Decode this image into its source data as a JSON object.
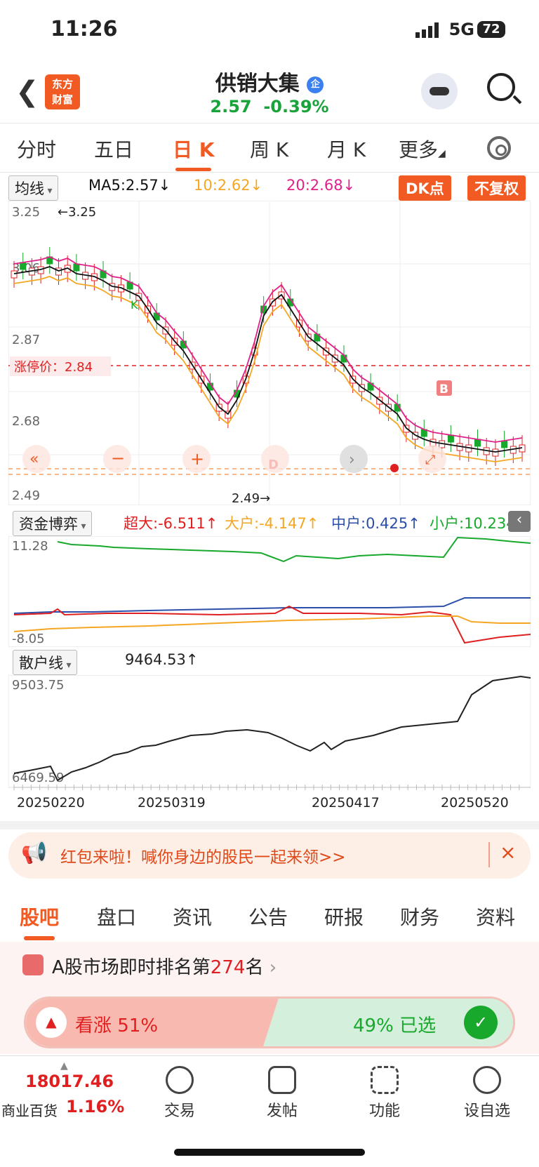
{
  "status": {
    "time": "11:26",
    "network": "5G",
    "battery": "72"
  },
  "header": {
    "logo_line1": "东方",
    "logo_line2": "财富",
    "stock_name": "供销大集",
    "badge": "企",
    "price": "2.57",
    "change": "-0.39%"
  },
  "period_tabs": [
    {
      "label": "分时"
    },
    {
      "label": "五日"
    },
    {
      "label": "日 K"
    },
    {
      "label": "周 K"
    },
    {
      "label": "月 K"
    },
    {
      "label": "更多"
    }
  ],
  "ma_row": {
    "select": "均线",
    "ma5": "MA5:2.57↓",
    "ma10": "10:2.62↓",
    "ma20": "20:2.68↓",
    "dk_button": "DK点",
    "fq_button": "不复权"
  },
  "kline": {
    "y_labels": [
      "3.25",
      "3.06",
      "2.87",
      "2.68",
      "2.49"
    ],
    "high_mark": "←3.25",
    "low_mark": "2.49→",
    "limit_label": "涨停价：2.84",
    "marker_b": "B",
    "marker_d": "D",
    "marker_k": "K"
  },
  "fund_row": {
    "select": "资金博弈",
    "super": "超大:-6.511↑",
    "large": "大户:-4.147↑",
    "mid": "中户:0.425↑",
    "small": "小户:10.234↑",
    "top": "11.28",
    "bottom": "-8.05"
  },
  "retail_row": {
    "select": "散户线",
    "value": "9464.53↑",
    "top": "9503.75",
    "bottom": "6469.59"
  },
  "dates": [
    "20250220",
    "20250319",
    "20250417",
    "20250520"
  ],
  "banner": {
    "text": "红包来啦！喊你身边的股民一起来领>>"
  },
  "section_tabs": [
    {
      "label": "股吧"
    },
    {
      "label": "盘口"
    },
    {
      "label": "资讯"
    },
    {
      "label": "公告"
    },
    {
      "label": "研报"
    },
    {
      "label": "财务"
    },
    {
      "label": "资料"
    }
  ],
  "rank": {
    "prefix": "A股市场即时排名第",
    "number": "274",
    "suffix": "名"
  },
  "vote": {
    "up_label": "看涨",
    "up_pct": "51%",
    "down_pct": "49%",
    "down_label": "已选"
  },
  "bottom_bar": {
    "index_value": "18017.46",
    "index_name": "商业百货",
    "index_change": "1.16%",
    "items": [
      {
        "label": "交易"
      },
      {
        "label": "发帖"
      },
      {
        "label": "功能"
      },
      {
        "label": "设自选"
      }
    ]
  },
  "colors": {
    "up": "#e02020",
    "down": "#17a82c",
    "accent": "#f15a22",
    "ma5": "#111111",
    "ma10": "#f5a623",
    "ma20": "#e0218a"
  }
}
